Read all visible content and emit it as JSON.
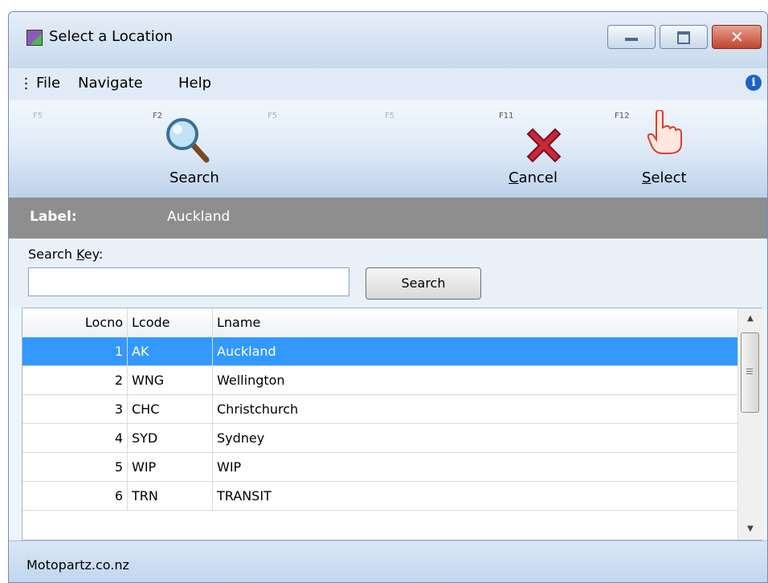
{
  "window": {
    "title": "Select a Location"
  },
  "menu": {
    "items": [
      "File",
      "Navigate",
      "Help"
    ]
  },
  "toolbar": {
    "fkeys": [
      "F5",
      "F2",
      "F5",
      "F5",
      "F11",
      "F12"
    ],
    "search_label": "Search",
    "cancel_label_u": "C",
    "cancel_label_rest": "ancel",
    "select_label_u": "S",
    "select_label_rest": "elect"
  },
  "label_bar": {
    "key": "Label:",
    "value": "Auckland"
  },
  "search": {
    "label_pre": "Search ",
    "label_u": "K",
    "label_post": "ey:",
    "value": "",
    "button": "Search"
  },
  "grid": {
    "columns": [
      "Locno",
      "Lcode",
      "Lname"
    ],
    "rows": [
      [
        "1",
        "AK",
        "Auckland"
      ],
      [
        "2",
        "WNG",
        "Wellington"
      ],
      [
        "3",
        "CHC",
        "Christchurch"
      ],
      [
        "4",
        "SYD",
        "Sydney"
      ],
      [
        "5",
        "WIP",
        "WIP"
      ],
      [
        "6",
        "TRN",
        "TRANSIT"
      ]
    ],
    "selected_row": 0
  },
  "status": {
    "text": "Motopartz.co.nz"
  },
  "colors": {
    "selection": "#3399ff",
    "label_bar": "#8e8e8e",
    "close_button": "#c0452e"
  }
}
